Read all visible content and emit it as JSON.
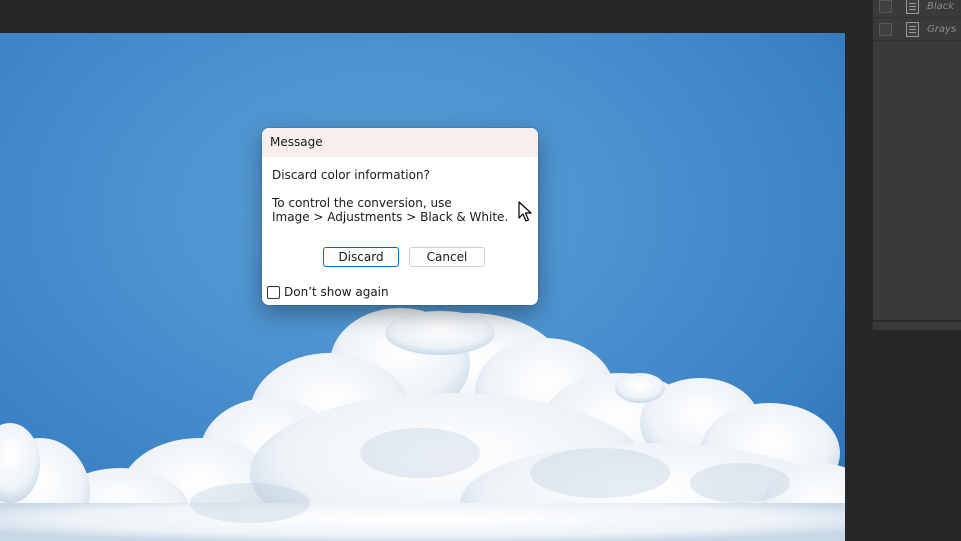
{
  "right_panel": {
    "items": [
      {
        "label": "Black &"
      },
      {
        "label": "Graysc"
      }
    ]
  },
  "dialog": {
    "title": "Message",
    "message": "Discard color information?",
    "detail_line1": "To control the conversion, use",
    "detail_line2": "Image > Adjustments > Black & White.",
    "discard_label": "Discard",
    "cancel_label": "Cancel",
    "dont_show_label": "Don’t show again",
    "dont_show_checked": false
  },
  "colors": {
    "sky": "#4a90cf",
    "primary_button_border": "#0067c0",
    "title_bar": "#f7efed"
  }
}
